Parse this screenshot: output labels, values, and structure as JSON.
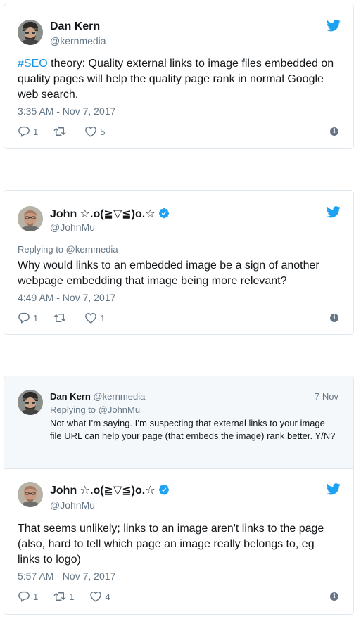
{
  "tweets": [
    {
      "name": "Dan Kern",
      "handle": "@kernmedia",
      "hashtag": "#SEO",
      "text": " theory: Quality external links to image files embedded on quality pages will help the quality page rank in normal Google web search.",
      "timestamp": "3:35 AM - Nov 7, 2017",
      "replies": "1",
      "retweets": "",
      "likes": "5"
    },
    {
      "name": "John ☆.o(≧▽≦)o.☆",
      "handle": "@JohnMu",
      "verified": true,
      "reply_to": "Replying to @kernmedia",
      "text": "Why would links to an embedded image be a sign of another webpage embedding that image being more relevant?",
      "timestamp": "4:49 AM - Nov 7, 2017",
      "replies": "1",
      "retweets": "",
      "likes": "1"
    },
    {
      "quoted": {
        "name": "Dan Kern",
        "handle": "@kernmedia",
        "date": "7 Nov",
        "reply_to": "Replying to @JohnMu",
        "text": "Not what I’m saying. I’m suspecting that external links to your image file URL can help your page (that embeds the image) rank better. Y/N?"
      },
      "name": "John ☆.o(≧▽≦)o.☆",
      "handle": "@JohnMu",
      "verified": true,
      "text": "That seems unlikely; links to an image aren't links to the page (also, hard to tell which page an image really belongs to, eg links to logo)",
      "timestamp": "5:57 AM - Nov 7, 2017",
      "replies": "1",
      "retweets": "1",
      "likes": "4"
    }
  ],
  "colors": {
    "link": "#1b95e0",
    "twitter_blue": "#1da1f2",
    "muted": "#657786",
    "border": "#e1e8ed"
  },
  "icons": {
    "brand": "twitter-bird-icon",
    "verified": "verified-badge-icon",
    "reply": "reply-icon",
    "retweet": "retweet-icon",
    "like": "heart-icon",
    "info": "info-icon"
  }
}
